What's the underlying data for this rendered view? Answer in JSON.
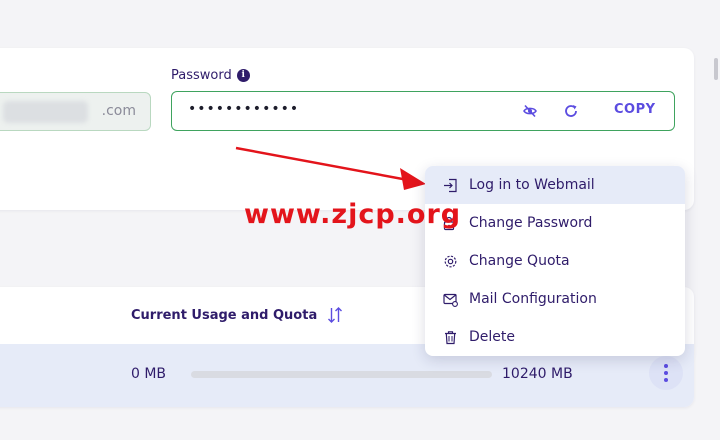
{
  "credentials": {
    "email_visible_suffix": ".com",
    "password_label": "Password",
    "password_value": "••••••••••••",
    "copy_label": "COPY"
  },
  "menu": {
    "items": [
      {
        "label": "Log in to Webmail",
        "icon": "login-icon"
      },
      {
        "label": "Change Password",
        "icon": "key-icon"
      },
      {
        "label": "Change Quota",
        "icon": "gear-icon"
      },
      {
        "label": "Mail Configuration",
        "icon": "mail-settings-icon"
      },
      {
        "label": "Delete",
        "icon": "trash-icon"
      }
    ]
  },
  "table": {
    "column_header": "Current Usage and Quota",
    "row": {
      "usage": "0 MB",
      "quota": "10240 MB",
      "usage_fraction": 0
    }
  },
  "watermark": "www.zjcp.org",
  "colors": {
    "accent": "#5b4ce0",
    "field_border_active": "#3fa35e",
    "text": "#2f1c6a",
    "watermark": "#e3141b"
  }
}
